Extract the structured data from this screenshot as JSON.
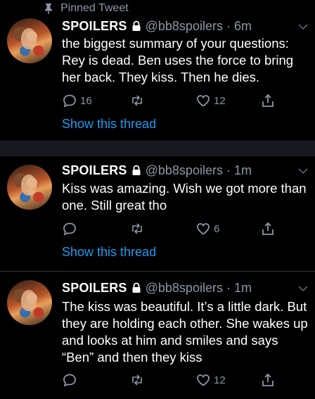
{
  "pinned_label": "Pinned Tweet",
  "colors": {
    "background": "#000000",
    "text": "#ffffff",
    "muted": "#8b98a5",
    "link": "#1d9bf0"
  },
  "tweets": [
    {
      "name": "SPOILERS",
      "handle": "@bb8spoilers · 6m",
      "text": "the biggest summary of your questions: Rey is dead. Ben uses the force to bring her back. They kiss. Then he dies.",
      "replies": "16",
      "likes": "12",
      "show_thread": "Show this thread"
    },
    {
      "name": "SPOILERS",
      "handle": "@bb8spoilers · 1m",
      "text": "Kiss was amazing. Wish we got more than one. Still great tho",
      "replies": "",
      "likes": "6",
      "show_thread": "Show this thread"
    },
    {
      "name": "SPOILERS",
      "handle": "@bb8spoilers · 1m",
      "text": "The kiss was beautiful. It’s a little dark. But they are holding each other. She wakes up and looks at him and smiles and says “Ben” and then they kiss",
      "replies": "",
      "likes": "12"
    }
  ]
}
